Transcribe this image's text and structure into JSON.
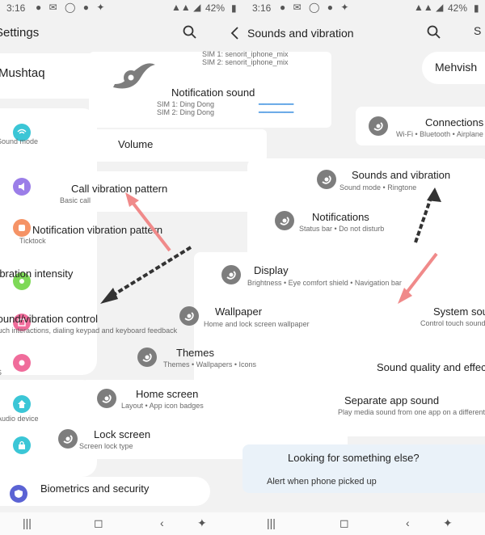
{
  "status": {
    "left_time": "3:16",
    "left_battery": "42%",
    "right_time": "3:16",
    "right_battery": "42%"
  },
  "left": {
    "header_title": "Settings",
    "profile_name": "Mushtaq",
    "rows": [
      {
        "title": "",
        "sub": "Sound mode"
      },
      {
        "title": "",
        "sub": ""
      },
      {
        "title": "Notification vibration pattern",
        "sub": "Ticktock"
      },
      {
        "title": "Vibration intensity",
        "sub": ""
      },
      {
        "title": "Sound/vibration control",
        "sub": "Touch interactions, dialing keypad and keyboard feedback"
      },
      {
        "title": "",
        "sub": "S"
      },
      {
        "title": "",
        "sub": "Audio device"
      },
      {
        "title": "Biometrics and security",
        "sub": ""
      }
    ]
  },
  "right": {
    "header_title": "Sounds and vibration",
    "profile_name": "Mehvish",
    "sim_lines": [
      "SIM 1: senorit_iphone_mix",
      "SIM 2: senorit_iphone_mix"
    ],
    "items": [
      {
        "title": "Connections",
        "sub": "Wi-Fi  •  Bluetooth  •  Airplane"
      },
      {
        "title": "System sound",
        "sub": "Control touch sounds"
      },
      {
        "title": "Sound quality and effects",
        "sub": ""
      },
      {
        "title": "Separate app sound",
        "sub": "Play media sound from one app on a different"
      }
    ],
    "looking_title": "Looking for something else?",
    "looking_sub": "Alert when phone picked up"
  },
  "center": {
    "notification_sound": {
      "title": "Notification sound",
      "sub1": "SIM 1: Ding Dong",
      "sub2": "SIM 2: Ding Dong"
    },
    "volume": {
      "title": "Volume"
    },
    "call_vibration": {
      "title": "Call vibration pattern",
      "sub": "Basic call"
    },
    "menu": [
      {
        "title": "Sounds and vibration",
        "sub": "Sound mode  •  Ringtone"
      },
      {
        "title": "Notifications",
        "sub": "Status bar  •  Do not disturb"
      },
      {
        "title": "Display",
        "sub": "Brightness  •  Eye comfort shield  •  Navigation bar"
      },
      {
        "title": "Wallpaper",
        "sub": "Home and lock screen wallpaper"
      },
      {
        "title": "Themes",
        "sub": "Themes  •  Wallpapers  •  Icons"
      },
      {
        "title": "Home screen",
        "sub": "Layout  •  App icon badges"
      },
      {
        "title": "Lock screen",
        "sub": "Screen lock type"
      }
    ]
  },
  "colors": {
    "accent_blue": "#3e91e0",
    "arrow_red": "#f08a8a",
    "arrow_dark": "#333333",
    "icon_cyan": "#3bc6d6",
    "icon_purple": "#9b7ee8",
    "icon_orange": "#f59366",
    "icon_green": "#7ed957",
    "icon_pink": "#f06c9b"
  },
  "icons": [
    "search-icon",
    "back-icon",
    "settings-rotate-icon",
    "profile-swirl-icon"
  ]
}
